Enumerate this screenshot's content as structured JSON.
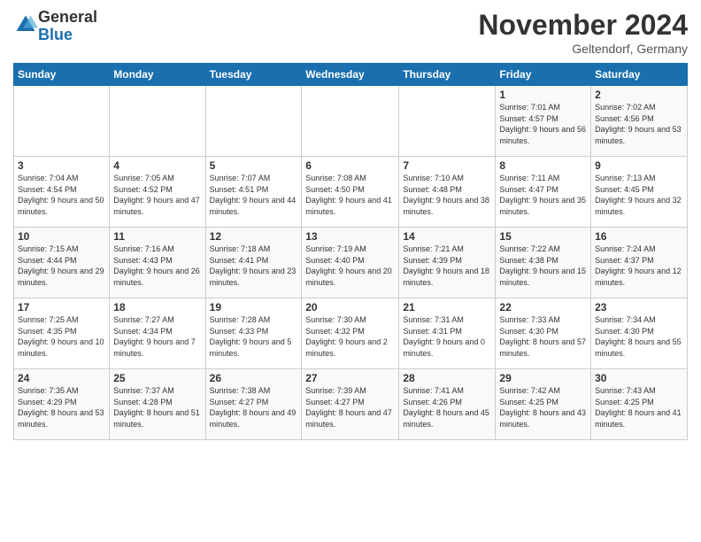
{
  "logo": {
    "general": "General",
    "blue": "Blue"
  },
  "title": "November 2024",
  "subtitle": "Geltendorf, Germany",
  "headers": [
    "Sunday",
    "Monday",
    "Tuesday",
    "Wednesday",
    "Thursday",
    "Friday",
    "Saturday"
  ],
  "weeks": [
    [
      {
        "day": "",
        "info": ""
      },
      {
        "day": "",
        "info": ""
      },
      {
        "day": "",
        "info": ""
      },
      {
        "day": "",
        "info": ""
      },
      {
        "day": "",
        "info": ""
      },
      {
        "day": "1",
        "info": "Sunrise: 7:01 AM\nSunset: 4:57 PM\nDaylight: 9 hours and 56 minutes."
      },
      {
        "day": "2",
        "info": "Sunrise: 7:02 AM\nSunset: 4:56 PM\nDaylight: 9 hours and 53 minutes."
      }
    ],
    [
      {
        "day": "3",
        "info": "Sunrise: 7:04 AM\nSunset: 4:54 PM\nDaylight: 9 hours and 50 minutes."
      },
      {
        "day": "4",
        "info": "Sunrise: 7:05 AM\nSunset: 4:52 PM\nDaylight: 9 hours and 47 minutes."
      },
      {
        "day": "5",
        "info": "Sunrise: 7:07 AM\nSunset: 4:51 PM\nDaylight: 9 hours and 44 minutes."
      },
      {
        "day": "6",
        "info": "Sunrise: 7:08 AM\nSunset: 4:50 PM\nDaylight: 9 hours and 41 minutes."
      },
      {
        "day": "7",
        "info": "Sunrise: 7:10 AM\nSunset: 4:48 PM\nDaylight: 9 hours and 38 minutes."
      },
      {
        "day": "8",
        "info": "Sunrise: 7:11 AM\nSunset: 4:47 PM\nDaylight: 9 hours and 35 minutes."
      },
      {
        "day": "9",
        "info": "Sunrise: 7:13 AM\nSunset: 4:45 PM\nDaylight: 9 hours and 32 minutes."
      }
    ],
    [
      {
        "day": "10",
        "info": "Sunrise: 7:15 AM\nSunset: 4:44 PM\nDaylight: 9 hours and 29 minutes."
      },
      {
        "day": "11",
        "info": "Sunrise: 7:16 AM\nSunset: 4:43 PM\nDaylight: 9 hours and 26 minutes."
      },
      {
        "day": "12",
        "info": "Sunrise: 7:18 AM\nSunset: 4:41 PM\nDaylight: 9 hours and 23 minutes."
      },
      {
        "day": "13",
        "info": "Sunrise: 7:19 AM\nSunset: 4:40 PM\nDaylight: 9 hours and 20 minutes."
      },
      {
        "day": "14",
        "info": "Sunrise: 7:21 AM\nSunset: 4:39 PM\nDaylight: 9 hours and 18 minutes."
      },
      {
        "day": "15",
        "info": "Sunrise: 7:22 AM\nSunset: 4:38 PM\nDaylight: 9 hours and 15 minutes."
      },
      {
        "day": "16",
        "info": "Sunrise: 7:24 AM\nSunset: 4:37 PM\nDaylight: 9 hours and 12 minutes."
      }
    ],
    [
      {
        "day": "17",
        "info": "Sunrise: 7:25 AM\nSunset: 4:35 PM\nDaylight: 9 hours and 10 minutes."
      },
      {
        "day": "18",
        "info": "Sunrise: 7:27 AM\nSunset: 4:34 PM\nDaylight: 9 hours and 7 minutes."
      },
      {
        "day": "19",
        "info": "Sunrise: 7:28 AM\nSunset: 4:33 PM\nDaylight: 9 hours and 5 minutes."
      },
      {
        "day": "20",
        "info": "Sunrise: 7:30 AM\nSunset: 4:32 PM\nDaylight: 9 hours and 2 minutes."
      },
      {
        "day": "21",
        "info": "Sunrise: 7:31 AM\nSunset: 4:31 PM\nDaylight: 9 hours and 0 minutes."
      },
      {
        "day": "22",
        "info": "Sunrise: 7:33 AM\nSunset: 4:30 PM\nDaylight: 8 hours and 57 minutes."
      },
      {
        "day": "23",
        "info": "Sunrise: 7:34 AM\nSunset: 4:30 PM\nDaylight: 8 hours and 55 minutes."
      }
    ],
    [
      {
        "day": "24",
        "info": "Sunrise: 7:35 AM\nSunset: 4:29 PM\nDaylight: 8 hours and 53 minutes."
      },
      {
        "day": "25",
        "info": "Sunrise: 7:37 AM\nSunset: 4:28 PM\nDaylight: 8 hours and 51 minutes."
      },
      {
        "day": "26",
        "info": "Sunrise: 7:38 AM\nSunset: 4:27 PM\nDaylight: 8 hours and 49 minutes."
      },
      {
        "day": "27",
        "info": "Sunrise: 7:39 AM\nSunset: 4:27 PM\nDaylight: 8 hours and 47 minutes."
      },
      {
        "day": "28",
        "info": "Sunrise: 7:41 AM\nSunset: 4:26 PM\nDaylight: 8 hours and 45 minutes."
      },
      {
        "day": "29",
        "info": "Sunrise: 7:42 AM\nSunset: 4:25 PM\nDaylight: 8 hours and 43 minutes."
      },
      {
        "day": "30",
        "info": "Sunrise: 7:43 AM\nSunset: 4:25 PM\nDaylight: 8 hours and 41 minutes."
      }
    ]
  ]
}
